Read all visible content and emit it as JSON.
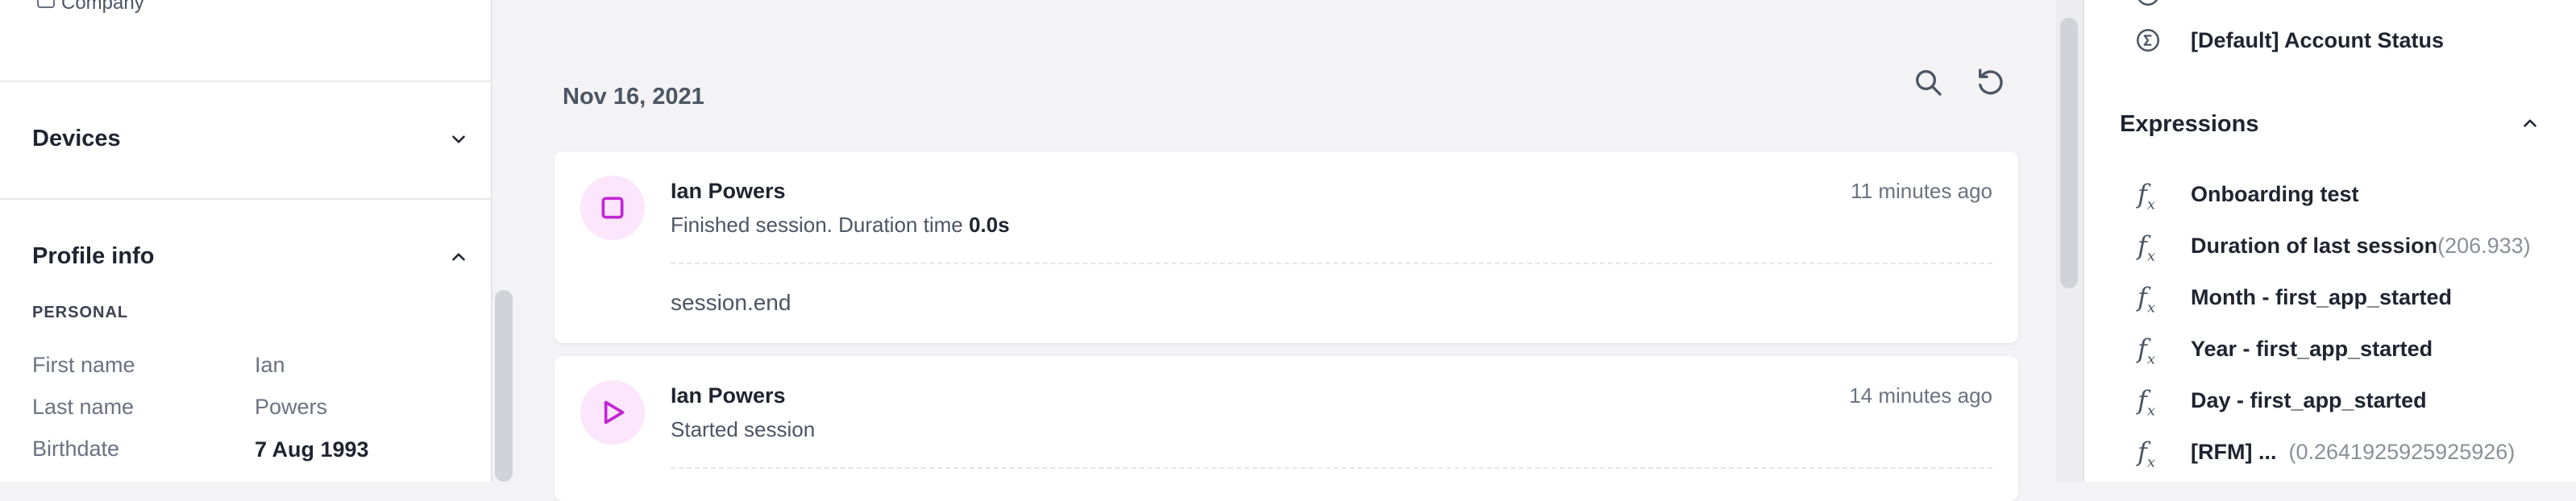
{
  "left": {
    "checkbox_label": "Company",
    "devices_title": "Devices",
    "profile_title": "Profile info",
    "personal_label": "PERSONAL",
    "rows": [
      {
        "key": "First name",
        "value": "Ian"
      },
      {
        "key": "Last name",
        "value": "Powers"
      },
      {
        "key": "Birthdate",
        "value": "7 Aug 1993"
      }
    ]
  },
  "center": {
    "date": "Nov 16, 2021",
    "cards": [
      {
        "icon": "stop-square-icon",
        "name": "Ian Powers",
        "desc": "Finished session. Duration time",
        "desc_strong": "0.0s",
        "time": "11 minutes ago",
        "event": "session.end"
      },
      {
        "icon": "play-icon",
        "name": "Ian Powers",
        "desc": "Started session",
        "time": "14 minutes ago"
      }
    ]
  },
  "right": {
    "account_status": "[Default] Account Status",
    "expressions_title": "Expressions",
    "expressions": [
      {
        "label": "Onboarding test",
        "value": ""
      },
      {
        "label": "Duration of last session",
        "value": "(206.933)"
      },
      {
        "label": "Month - first_app_started",
        "value": ""
      },
      {
        "label": "Year - first_app_started",
        "value": ""
      },
      {
        "label": "Day - first_app_started",
        "value": ""
      },
      {
        "label": "[RFM] ...",
        "value": "(0.2641925925925926)"
      }
    ]
  },
  "colors": {
    "accent": "#c026d3",
    "accent_bg": "#fbe6fb"
  }
}
